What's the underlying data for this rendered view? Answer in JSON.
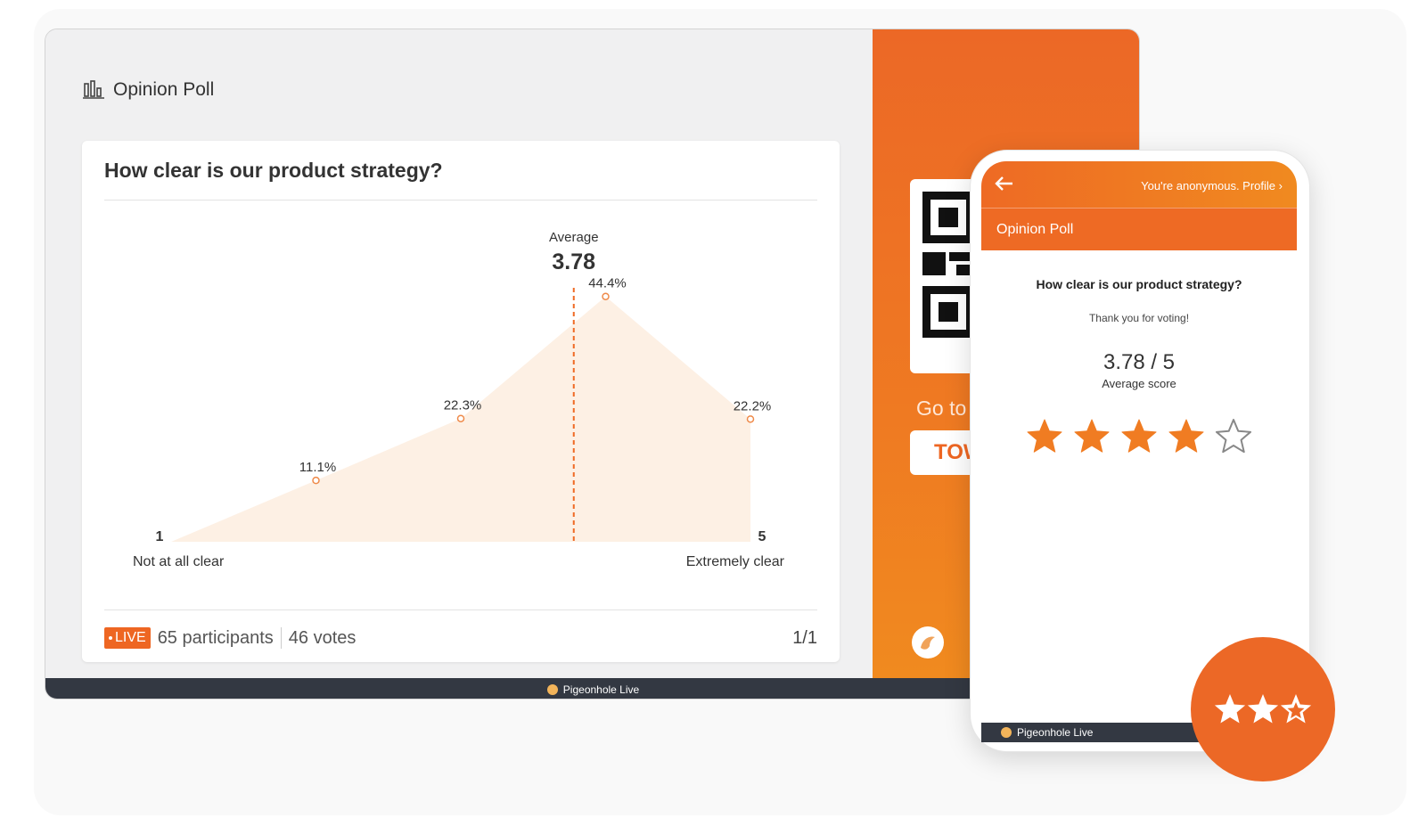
{
  "desktop": {
    "header_title": "Opinion Poll",
    "question": "How clear is our product strategy?",
    "footer_brand": "Pigeonhole Live",
    "live_label": "LIVE",
    "participants": "65 participants",
    "votes": "46 votes",
    "page": "1/1",
    "side_goto": "Go to",
    "side_code": "TOW"
  },
  "chart_data": {
    "type": "area",
    "x": [
      1,
      2,
      3,
      4,
      5
    ],
    "values": [
      0,
      11.1,
      22.3,
      44.4,
      22.2
    ],
    "data_labels": [
      "11.1%",
      "22.3%",
      "44.4%",
      "22.2%"
    ],
    "x_min_label": "1",
    "x_max_label": "5",
    "x_min_caption": "Not at all clear",
    "x_max_caption": "Extremely clear",
    "average_label": "Average",
    "average_value": 3.78,
    "average_text": "3.78",
    "ylim": [
      0,
      50
    ],
    "colors": {
      "fill": "#fdf0e4",
      "marker": "#ef8a4a",
      "average_line": "#ef6a24"
    }
  },
  "phone": {
    "anon_text": "You're anonymous. Profile",
    "title": "Opinion Poll",
    "question": "How clear is our product strategy?",
    "thanks": "Thank you for voting!",
    "score": "3.78 / 5",
    "score_label": "Average score",
    "stars_filled": 4,
    "stars_total": 5,
    "footer_brand": "Pigeonhole Live"
  },
  "badge": {
    "stars": 3
  },
  "colors": {
    "accent": "#ee6622",
    "footer": "#333842"
  }
}
